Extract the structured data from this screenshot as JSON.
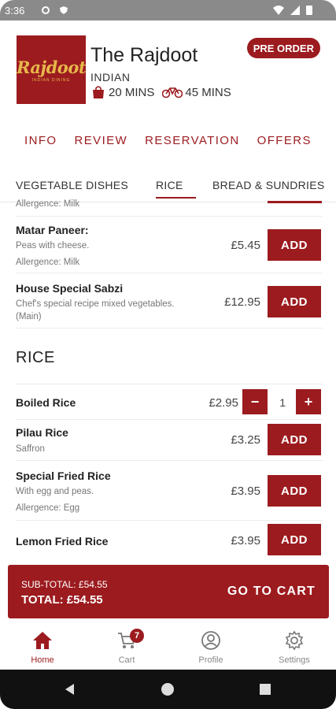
{
  "status_bar": {
    "time": "3:36"
  },
  "restaurant": {
    "logo_text": "Rajdoot",
    "logo_prefix": "The",
    "logo_sub": "INDIAN DINING",
    "name": "The Rajdoot",
    "cuisine": "INDIAN",
    "collection_time": "20 MINS",
    "delivery_time": "45 MINS",
    "preorder_label": "PRE ORDER"
  },
  "info_tabs": [
    "INFO",
    "REVIEW",
    "RESERVATION",
    "OFFERS"
  ],
  "category_tabs": [
    "VEGETABLE DISHES",
    "RICE",
    "BREAD & SUNDRIES"
  ],
  "menu": {
    "partial_allergence": "Allergence: Milk",
    "veg_items": [
      {
        "name": "Matar Paneer:",
        "desc": "Peas with cheese.",
        "allergence": "Allergence: Milk",
        "price": "£5.45",
        "action": "ADD"
      },
      {
        "name": "House Special Sabzi",
        "desc": "Chef's special recipe mixed vegetables.",
        "desc2": "(Main)",
        "price": "£12.95",
        "action": "ADD"
      }
    ],
    "rice_section_title": "RICE",
    "rice_items": [
      {
        "name": "Boiled Rice",
        "price": "£2.95",
        "qty": "1",
        "minus": "−",
        "plus": "+"
      },
      {
        "name": "Pilau Rice",
        "desc": "Saffron",
        "price": "£3.25",
        "action": "ADD"
      },
      {
        "name": "Special Fried Rice",
        "desc": "With egg and peas.",
        "allergence": "Allergence: Egg",
        "price": "£3.95",
        "action": "ADD"
      },
      {
        "name": "Lemon Fried Rice",
        "price": "£3.95",
        "action": "ADD"
      }
    ]
  },
  "cart": {
    "subtotal": "SUB-TOTAL: £54.55",
    "total": "TOTAL: £54.55",
    "goto_label": "GO TO CART"
  },
  "bottom_nav": {
    "home": "Home",
    "cart": "Cart",
    "cart_badge": "7",
    "profile": "Profile",
    "settings": "Settings"
  },
  "colors": {
    "brand": "#9c1b1f",
    "logo_gold": "#e6b84a"
  }
}
